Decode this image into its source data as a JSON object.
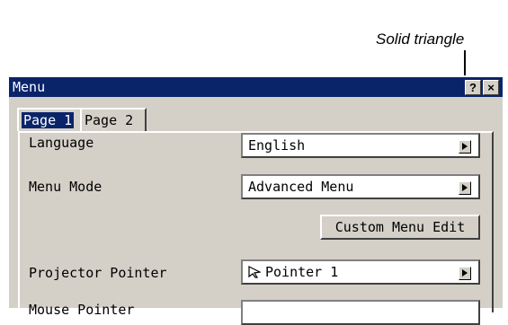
{
  "annotation": {
    "text": "Solid triangle"
  },
  "window": {
    "title": "Menu",
    "help_label": "?",
    "close_label": "×",
    "tabs": [
      {
        "label": "Page 1",
        "selected": true
      },
      {
        "label": "Page 2",
        "selected": false
      }
    ],
    "settings": [
      {
        "label": "Language",
        "value": "English"
      },
      {
        "label": "Menu Mode",
        "value": "Advanced Menu"
      },
      {
        "label": "Projector Pointer",
        "value": "Pointer 1"
      }
    ],
    "custom_menu_button": "Custom Menu Edit",
    "partial_row_label": "Mouse Pointer"
  },
  "colors": {
    "titlebar": "#0a246a",
    "window_bg": "#d4d0c8"
  },
  "icons": {
    "dropdown": "solid-triangle-icon",
    "pointer": "arrow-pointer-icon"
  }
}
